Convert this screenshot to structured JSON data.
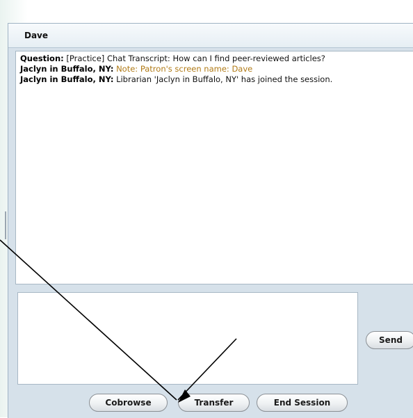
{
  "header": {
    "title": "Dave"
  },
  "transcript": {
    "lines": [
      {
        "speaker": "Question:",
        "text": " [Practice] Chat Transcript: How can I find peer-reviewed articles?",
        "style": "normal"
      },
      {
        "speaker": "Jaclyn in Buffalo, NY:",
        "text": " Note: Patron's screen name: Dave",
        "style": "note"
      },
      {
        "speaker": "Jaclyn in Buffalo, NY:",
        "text": " Librarian 'Jaclyn in Buffalo, NY' has joined the session.",
        "style": "normal"
      }
    ]
  },
  "compose": {
    "value": ""
  },
  "buttons": {
    "send": "Send",
    "cobrowse": "Cobrowse",
    "transfer": "Transfer",
    "end_session": "End Session"
  },
  "colors": {
    "note": "#b07a16",
    "panel": "#d6e1ea"
  }
}
